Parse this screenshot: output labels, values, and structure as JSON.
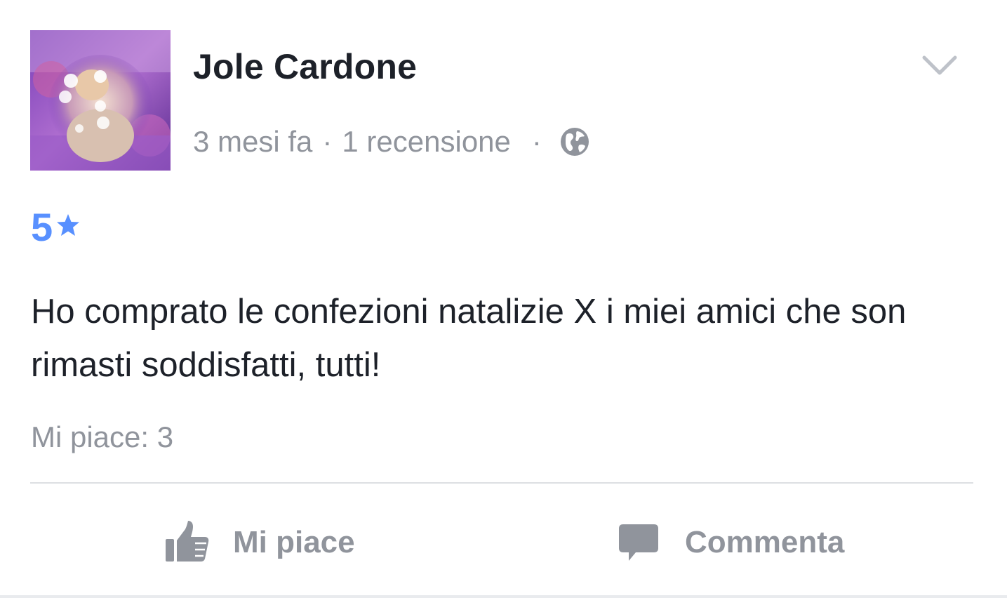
{
  "post": {
    "author": "Jole Cardone",
    "time": "3 mesi fa",
    "separator": "·",
    "review_count": "1 recensione",
    "privacy_icon": "globe-icon",
    "rating_value": "5",
    "rating_icon": "star-icon",
    "text": "Ho comprato le confezioni natalizie X i miei amici che son rimasti soddisfatti, tutti!",
    "likes_label": "Mi piace: 3",
    "colors": {
      "accent": "#5890ff",
      "secondary_text": "#90949c",
      "primary_text": "#1d2129"
    }
  },
  "actions": {
    "like_label": "Mi piace",
    "like_icon": "thumbs-up-icon",
    "comment_label": "Commenta",
    "comment_icon": "comment-bubble-icon"
  },
  "menu": {
    "icon": "chevron-down-icon"
  }
}
